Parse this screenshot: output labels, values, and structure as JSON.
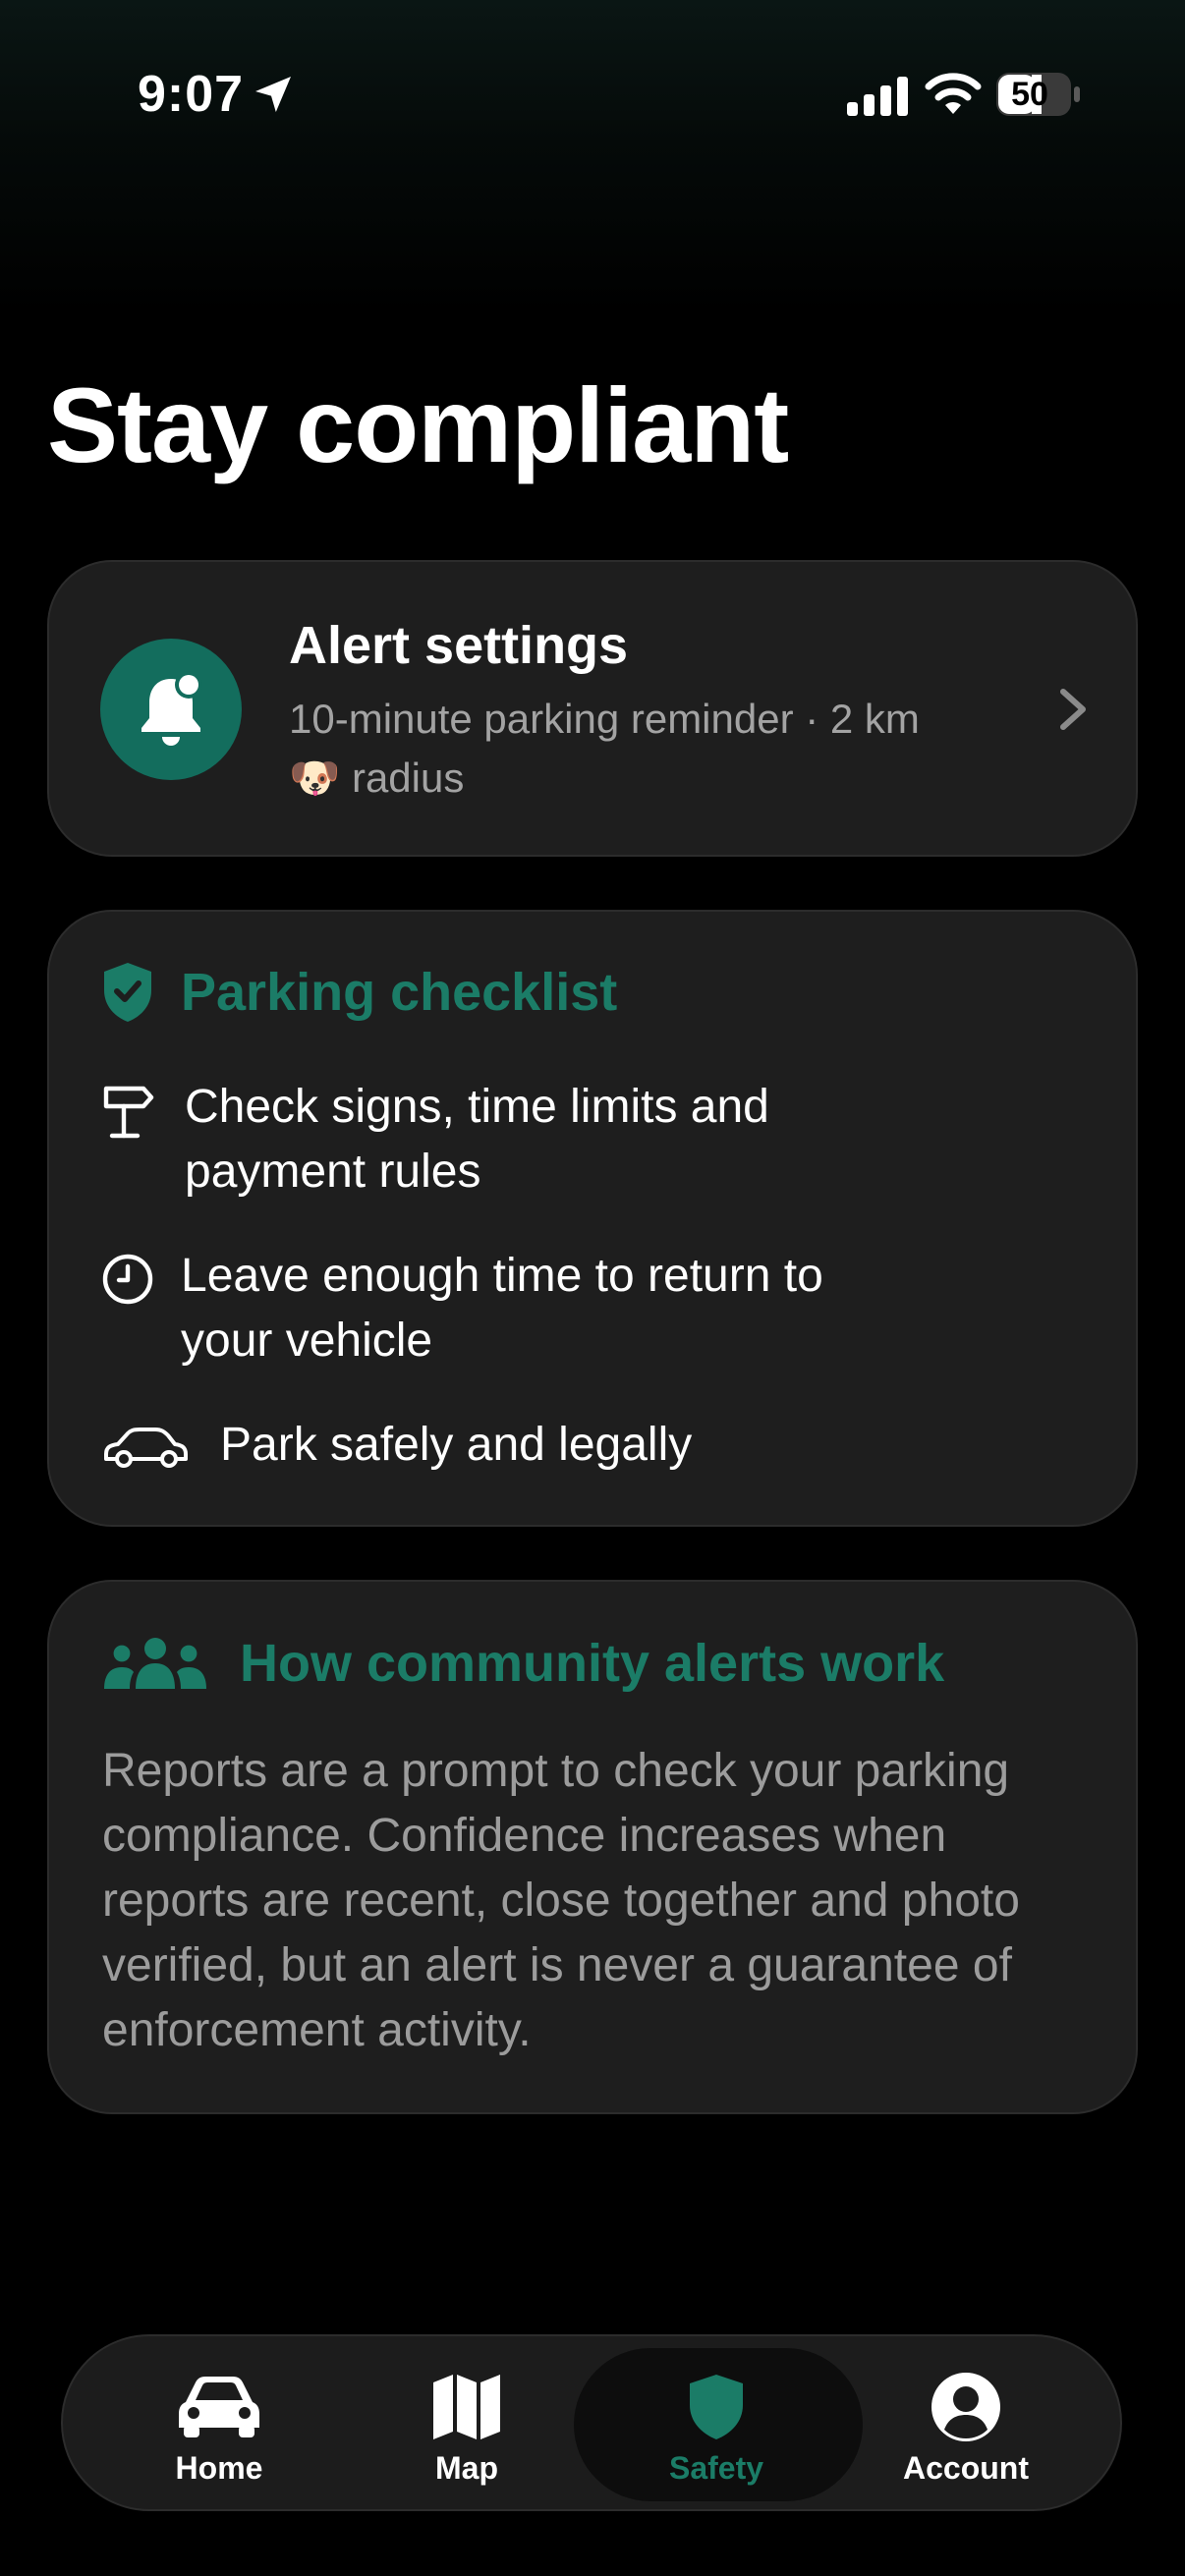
{
  "status_bar": {
    "time": "9:07",
    "battery": "50"
  },
  "title": "Stay compliant",
  "alert_settings": {
    "title": "Alert settings",
    "subtitle": "10-minute parking reminder · 2 km 🐶 radius",
    "icon": "bell-icon"
  },
  "checklist": {
    "title": "Parking checklist",
    "items": [
      {
        "icon": "signpost-icon",
        "text": "Check signs, time limits and payment rules"
      },
      {
        "icon": "clock-icon",
        "text": "Leave enough time to return to your vehicle"
      },
      {
        "icon": "car-outline-icon",
        "text": "Park safely and legally"
      }
    ]
  },
  "community": {
    "title": "How community alerts work",
    "body": "Reports are a prompt to check your parking compliance. Confidence increases when reports are recent, close together and photo verified, but an alert is never a guarantee of enforcement activity."
  },
  "tabs": [
    {
      "label": "Home",
      "icon": "car-icon",
      "active": false
    },
    {
      "label": "Map",
      "icon": "map-icon",
      "active": false
    },
    {
      "label": "Safety",
      "icon": "shield-icon",
      "active": true
    },
    {
      "label": "Account",
      "icon": "account-icon",
      "active": false
    }
  ],
  "colors": {
    "accent": "#1b7c67",
    "alert_circle": "#136d5d",
    "card": "#1e1e1e",
    "background": "#000000"
  }
}
